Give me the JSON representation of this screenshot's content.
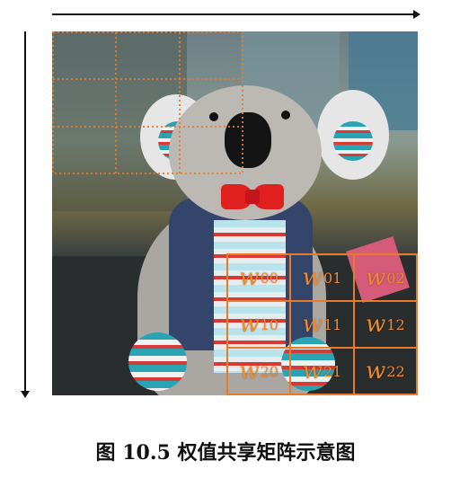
{
  "caption": "图 10.5 权值共享矩阵示意图",
  "kernel": {
    "cells": [
      {
        "base": "w",
        "sub": "00"
      },
      {
        "base": "w",
        "sub": "01"
      },
      {
        "base": "w",
        "sub": "02"
      },
      {
        "base": "w",
        "sub": "10"
      },
      {
        "base": "w",
        "sub": "11"
      },
      {
        "base": "w",
        "sub": "12"
      },
      {
        "base": "w",
        "sub": "20"
      },
      {
        "base": "w",
        "sub": "21"
      },
      {
        "base": "w",
        "sub": "22"
      }
    ]
  },
  "colors": {
    "kernel": "#e87a2c",
    "arrows": "#111111"
  }
}
